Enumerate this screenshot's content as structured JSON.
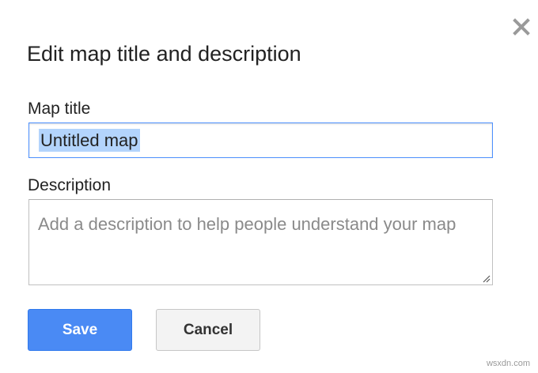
{
  "dialog": {
    "title": "Edit map title and description",
    "close_icon": "close-icon"
  },
  "map_title": {
    "label": "Map title",
    "value": "Untitled map"
  },
  "description": {
    "label": "Description",
    "placeholder": "Add a description to help people understand your map",
    "value": ""
  },
  "buttons": {
    "save_label": "Save",
    "cancel_label": "Cancel"
  },
  "colors": {
    "save_button": "#4a8af4",
    "focus_border": "#4d90fe",
    "selection": "#b3d4fc"
  },
  "watermark": "wsxdn.com"
}
